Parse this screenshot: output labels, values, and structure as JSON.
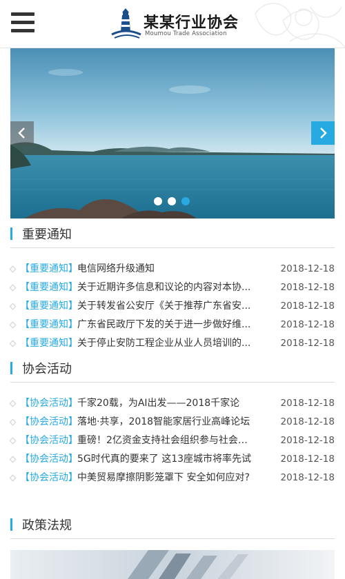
{
  "header": {
    "logo_title": "某某行业协会",
    "logo_subtitle": "Moumou Trade Association",
    "menu_icon": "hamburger-menu-icon"
  },
  "banner": {
    "prev_icon": "chevron-left-icon",
    "next_icon": "chevron-right-icon",
    "dots_count": 3,
    "active_dot": 3,
    "colors": {
      "accent": "#27a9e1"
    }
  },
  "sections": {
    "notice": {
      "title": "重要通知",
      "items": [
        {
          "tag": "【重要通知】",
          "title": "电信网络升级通知",
          "date": "2018-12-18"
        },
        {
          "tag": "【重要通知】",
          "title": "关于近期许多信息和议论的内容对本协...",
          "date": "2018-12-18"
        },
        {
          "tag": "【重要通知】",
          "title": "关于转发省公安厅《关于推荐广东省安...",
          "date": "2018-12-18"
        },
        {
          "tag": "【重要通知】",
          "title": "广东省民政厅下发的关于进一步做好维...",
          "date": "2018-12-18"
        },
        {
          "tag": "【重要通知】",
          "title": "关于停止安防工程企业从业人员培训的...",
          "date": "2018-12-18"
        }
      ]
    },
    "activity": {
      "title": "协会活动",
      "items": [
        {
          "tag": "【协会活动】",
          "title": "千家20载，为AI出发——2018千家论",
          "date": "2018-12-18"
        },
        {
          "tag": "【协会活动】",
          "title": "落地·共享，2018智能家居行业高峰论坛",
          "date": "2018-12-18"
        },
        {
          "tag": "【协会活动】",
          "title": "重磅！2亿资金支持社会组织参与社会服...",
          "date": "2018-12-18"
        },
        {
          "tag": "【协会活动】",
          "title": "5G时代真的要来了 这13座城市将率先试",
          "date": "2018-12-18"
        },
        {
          "tag": "【协会活动】",
          "title": "中美贸易摩擦阴影笼罩下 安全如何应对?",
          "date": "2018-12-18"
        }
      ]
    },
    "policy": {
      "title": "政策法规"
    }
  }
}
